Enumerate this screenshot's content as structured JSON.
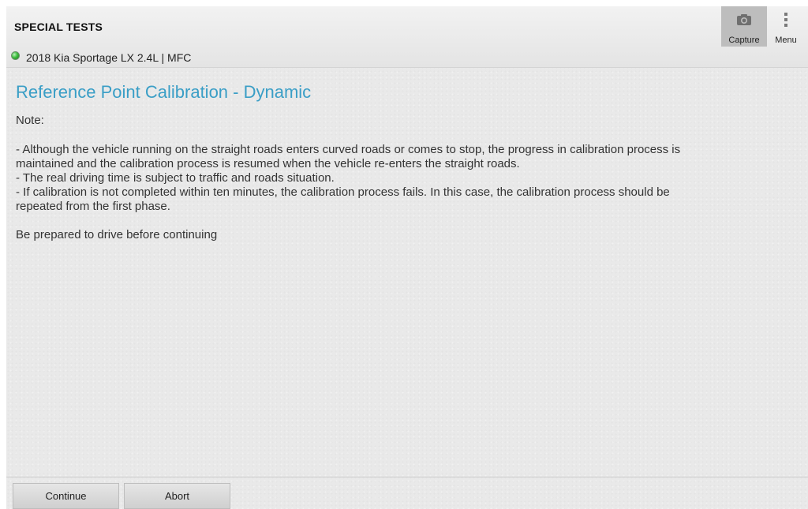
{
  "header": {
    "title": "SPECIAL TESTS",
    "vehicle": "2018 Kia Sportage LX 2.4L | MFC",
    "status_color": "#3fbf3f"
  },
  "toolbar": {
    "capture_label": "Capture",
    "capture_icon": "camera-icon",
    "menu_label": "Menu",
    "menu_icon": "more-vertical-icon"
  },
  "main": {
    "heading": "Reference Point Calibration - Dynamic",
    "heading_color": "#3a9ec6",
    "note_label": "Note:",
    "paragraph_lines": [
      "- Although the vehicle running on the straight roads enters curved roads or comes to stop, the progress in calibration process is",
      "maintained and the calibration process is resumed when the vehicle re-enters the straight roads.",
      "- The real driving time is subject to traffic and roads situation.",
      "- If calibration is not completed within ten minutes, the calibration process fails. In this case, the calibration process should be",
      "repeated from the first phase."
    ],
    "prepare_text": "Be prepared to drive before continuing"
  },
  "footer": {
    "continue_label": "Continue",
    "abort_label": "Abort"
  }
}
